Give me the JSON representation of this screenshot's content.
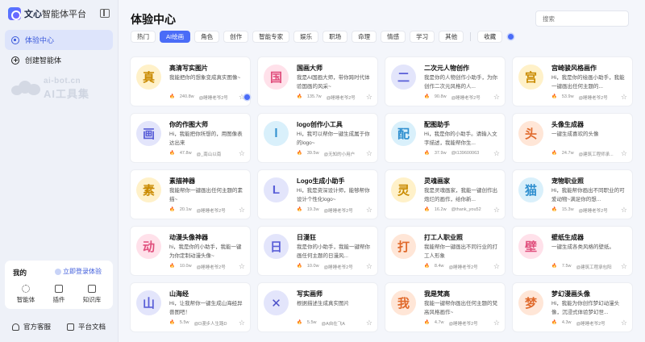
{
  "brand": {
    "name": "文心",
    "sub": "智能体平台"
  },
  "nav": [
    {
      "label": "体验中心",
      "active": true
    },
    {
      "label": "创建智能体",
      "active": false
    }
  ],
  "watermark": {
    "line1": "ai-bot.cn",
    "line2": "AI工具集"
  },
  "my": {
    "title": "我的",
    "login": "立即登录体验",
    "tools": [
      {
        "label": "智能体"
      },
      {
        "label": "插件"
      },
      {
        "label": "知识库"
      }
    ]
  },
  "footer": {
    "service": "官方客服",
    "docs": "平台文档"
  },
  "page": {
    "title": "体验中心",
    "search_placeholder": "搜索"
  },
  "tabs": [
    "热门",
    "AI绘画",
    "角色",
    "创作",
    "智能专家",
    "娱乐",
    "职场",
    "命理",
    "情感",
    "学习",
    "其他"
  ],
  "active_tab": "AI绘画",
  "fav_label": "收藏",
  "cards": [
    {
      "glyph": "真",
      "bg": "#fff1c9",
      "fg": "#c98a00",
      "title": "高清写实图片",
      "desc": "我能把你的想象变成真实图像~",
      "views": "240.8w",
      "author": "@睡睡老爷2号"
    },
    {
      "glyph": "国",
      "bg": "#ffe1ea",
      "fg": "#e04f7d",
      "title": "国画大师",
      "desc": "我是AI国画大师，带你跨时代体验国画的风采~",
      "views": "135.7w",
      "author": "@睡睡老爷2号"
    },
    {
      "glyph": "二",
      "bg": "#e3e5fb",
      "fg": "#5a5fd8",
      "title": "二次元人物创作",
      "desc": "我是你的人物创作小助手，为你创作二次元风格的人...",
      "views": "90.8w",
      "author": "@睡睡老爷2号"
    },
    {
      "glyph": "宫",
      "bg": "#fff1c9",
      "fg": "#c98a00",
      "title": "宫崎骏风格画作",
      "desc": "Hi，我是你的绘画小助手，我能一键画出任何主题的...",
      "views": "53.9w",
      "author": "@睡睡老爷2号"
    },
    {
      "glyph": "画",
      "bg": "#e3e5fb",
      "fg": "#5a5fd8",
      "title": "你的作图大师",
      "desc": "Hi，我能把你所想的，用图像表达出来",
      "views": "47.8w",
      "author": "@_南山以南"
    },
    {
      "glyph": "l",
      "bg": "#d9f0fb",
      "fg": "#2f8fcf",
      "title": "logo创作小工具",
      "desc": "Hi，我可以帮你一键生成属于你的logo~",
      "views": "39.5w",
      "author": "@无知的小用户"
    },
    {
      "glyph": "配",
      "bg": "#d9f0fb",
      "fg": "#2f8fcf",
      "title": "配图助手",
      "desc": "Hi，我是你的小助手。请输入文字描述，我能帮你生...",
      "views": "37.9w",
      "author": "@t139600063"
    },
    {
      "glyph": "头",
      "bg": "#ffe6d7",
      "fg": "#e06a2c",
      "title": "头像生成器",
      "desc": "一键生成喜欢的头像",
      "views": "24.7w",
      "author": "@建筑工程师承..."
    },
    {
      "glyph": "素",
      "bg": "#fff1c9",
      "fg": "#c98a00",
      "title": "素描神器",
      "desc": "我能帮你一键画出任何主题的素描~",
      "views": "20.1w",
      "author": "@睡睡老爷2号"
    },
    {
      "glyph": "L",
      "bg": "#e3e5fb",
      "fg": "#5a5fd8",
      "title": "Logo生成小助手",
      "desc": "Hi，我是资深设计师，能够帮你设计个性化logo~",
      "views": "19.3w",
      "author": "@睡睡老爷2号"
    },
    {
      "glyph": "灵",
      "bg": "#fff1c9",
      "fg": "#c98a00",
      "title": "灵魂画家",
      "desc": "我是灵魂画家，我能一键创作出炮烂的画作，给你新...",
      "views": "16.2w",
      "author": "@thank_you52"
    },
    {
      "glyph": "猫",
      "bg": "#d9f0fb",
      "fg": "#2f8fcf",
      "title": "宠物职业照",
      "desc": "Hi，我能帮你画出不同职业的可爱动物~满足你的想...",
      "views": "15.3w",
      "author": "@睡睡老爷2号"
    },
    {
      "glyph": "动",
      "bg": "#ffe1ea",
      "fg": "#e04f7d",
      "title": "动漫头像神器",
      "desc": "hi，我是你的小助手，我能一键为你定制动漫头像~",
      "views": "10.0w",
      "author": "@睡睡老爷2号"
    },
    {
      "glyph": "日",
      "bg": "#e3e5fb",
      "fg": "#5a5fd8",
      "title": "日漫狂",
      "desc": "我是你的小助手，我能一键帮你画任何主题的日漫风...",
      "views": "10.0w",
      "author": "@睡睡老爷2号"
    },
    {
      "glyph": "打",
      "bg": "#ffe6d7",
      "fg": "#e06a2c",
      "title": "打工人职业照",
      "desc": "我能帮你一键画出不同行业的打工人形象",
      "views": "8.4w",
      "author": "@睡睡老爷2号"
    },
    {
      "glyph": "壁",
      "bg": "#ffe1ea",
      "fg": "#e04f7d",
      "title": "壁纸生成器",
      "desc": "一键生成各类风格的壁纸。",
      "views": "7.5w",
      "author": "@建筑工程承包阳"
    },
    {
      "glyph": "山",
      "bg": "#e3e5fb",
      "fg": "#5a5fd8",
      "title": "山海经",
      "desc": "Hi，让我帮你一键生成山海经异兽图吧！",
      "views": "5.5w",
      "author": "@D漫步人生路D"
    },
    {
      "glyph": "✕",
      "bg": "#e3e5fb",
      "fg": "#4a4fc8",
      "title": "写实画师",
      "desc": "根据描述生成真实图片",
      "views": "5.5w",
      "author": "@A自在飞A"
    },
    {
      "glyph": "我",
      "bg": "#ffe6d7",
      "fg": "#e06a2c",
      "title": "我是梵高",
      "desc": "我能一键帮你画出任何主题的梵高风格画作~",
      "views": "4.7w",
      "author": "@睡睡老爷2号"
    },
    {
      "glyph": "梦",
      "bg": "#ffe6d7",
      "fg": "#e06a2c",
      "title": "梦幻漫画头像",
      "desc": "Hi，我能为你创作梦幻动漫头像，沉浸式体验梦幻世...",
      "views": "4.3w",
      "author": "@睡睡老爷2号"
    }
  ]
}
